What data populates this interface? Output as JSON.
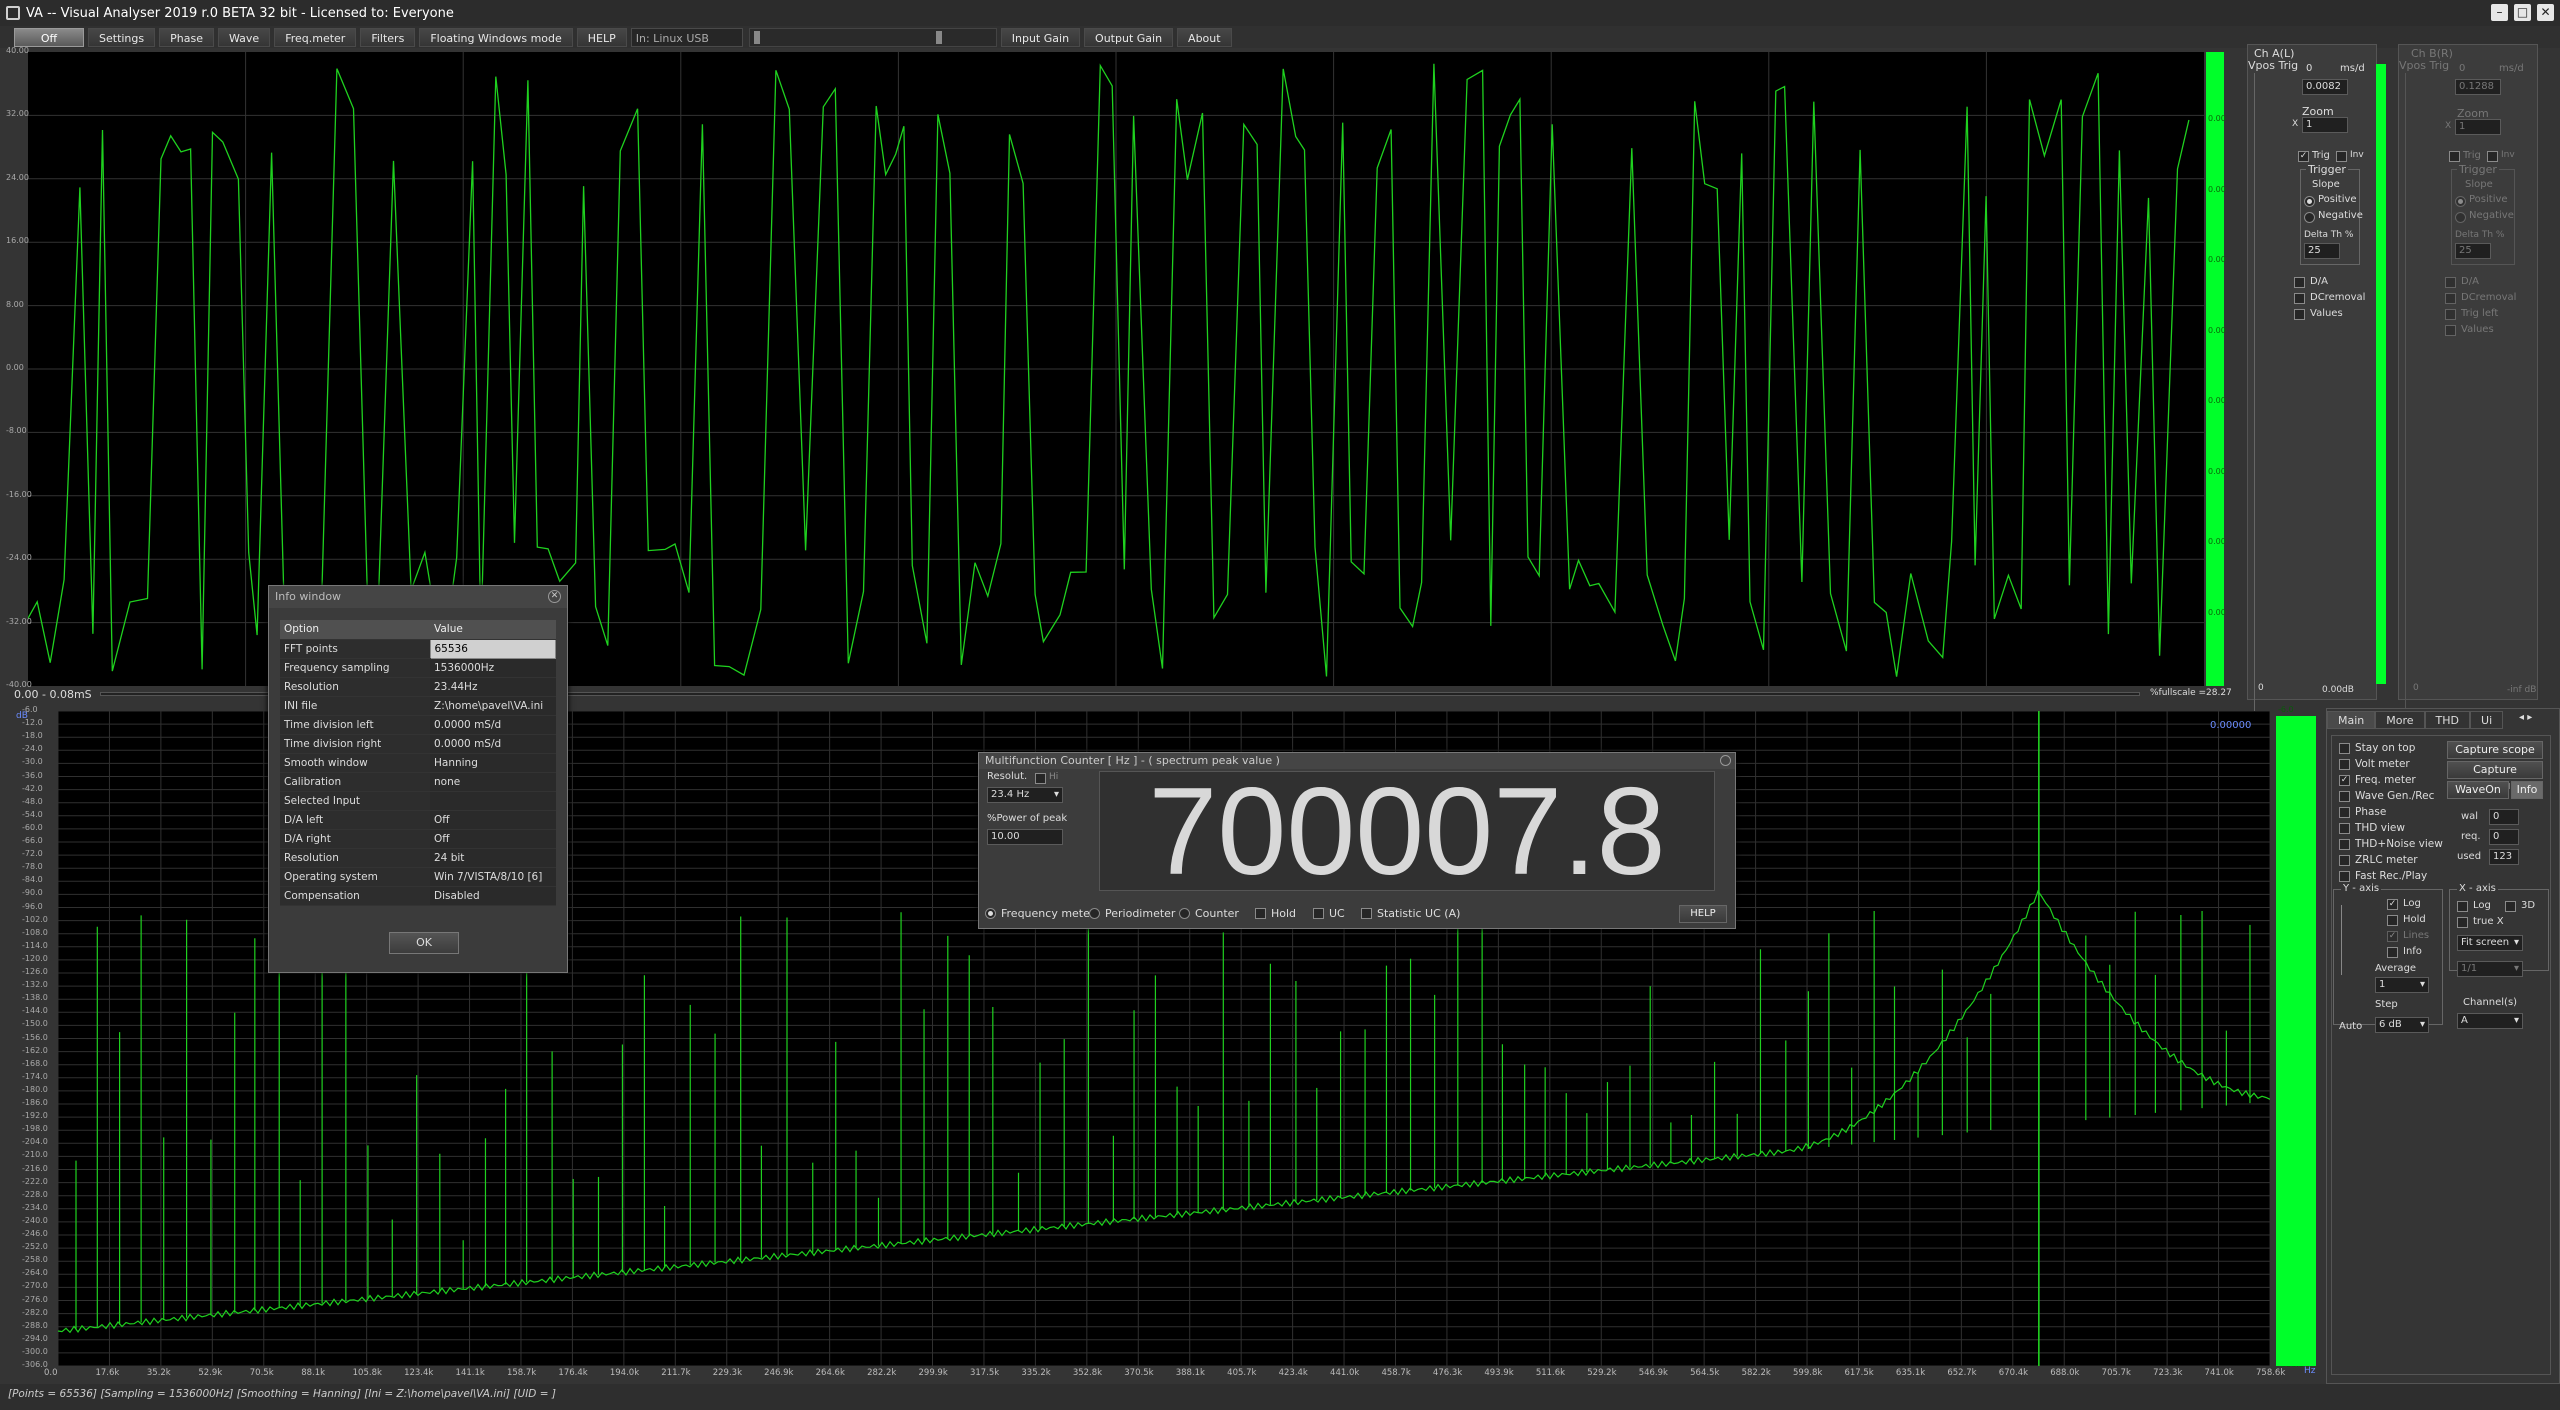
{
  "window": {
    "title": "VA -- Visual Analyser 2019 r.0 BETA 32 bit - Licensed to: Everyone"
  },
  "menu": {
    "items": [
      "Off",
      "Settings",
      "Phase",
      "Wave",
      "Freq.meter",
      "Filters",
      "Floating Windows mode",
      "HELP"
    ],
    "input_device": "In: Linux USB Audio",
    "input_gain": "Input Gain",
    "output_gain": "Output Gain",
    "about": "About"
  },
  "scope": {
    "y_ticks": [
      "40.00",
      "32.00",
      "24.00",
      "16.00",
      "8.00",
      "0.00",
      "-8.00",
      "-16.00",
      "-24.00",
      "-32.00",
      "-40.00"
    ],
    "right_ticks": [
      "0.00",
      "0.00",
      "0.00",
      "0.00",
      "0.00",
      "0.00",
      "0.00",
      "0.00"
    ],
    "time_label": "0.00 - 0.08mS",
    "fullscale_label": "%fullscale =28.27"
  },
  "ch_a": {
    "title": "Ch A(L)",
    "vpos_trig": "Vpos Trig",
    "ms_unit": "ms/d",
    "ms_a": "0",
    "ms_b": "0.0082",
    "zoom_label": "Zoom",
    "zoom_value": "1",
    "x_label": "X",
    "trig_label": "Trig",
    "inv_label": "Inv",
    "trigger_title": "Trigger",
    "slope_label": "Slope",
    "positive": "Positive",
    "negative": "Negative",
    "delta_label": "Delta Th %",
    "delta_value": "25",
    "da": "D/A",
    "dcremoval": "DCremoval",
    "values": "Values",
    "db_label": "0.00dB",
    "zero_label": "0"
  },
  "ch_b": {
    "title": "Ch B(R)",
    "vpos_trig": "Vpos Trig",
    "ms_unit": "ms/d",
    "ms_a": "0",
    "ms_b": "0.1288",
    "zoom_label": "Zoom",
    "zoom_value": "1",
    "x_label": "X",
    "trig_label": "Trig",
    "inv_label": "Inv",
    "trigger_title": "Trigger",
    "slope_label": "Slope",
    "positive": "Positive",
    "negative": "Negative",
    "delta_label": "Delta Th %",
    "delta_value": "25",
    "da": "D/A",
    "dcremoval": "DCremoval",
    "trig_left": "Trig left",
    "values": "Values",
    "db_label": "-inf dB",
    "zero_label": "0"
  },
  "spectrum": {
    "y_ticks": [
      "-6.0",
      "-12.0",
      "-18.0",
      "-24.0",
      "-30.0",
      "-36.0",
      "-42.0",
      "-48.0",
      "-54.0",
      "-60.0",
      "-66.0",
      "-72.0",
      "-78.0",
      "-84.0",
      "-90.0",
      "-96.0",
      "-102.0",
      "-108.0",
      "-114.0",
      "-120.0",
      "-126.0",
      "-132.0",
      "-138.0",
      "-144.0",
      "-150.0",
      "-156.0",
      "-162.0",
      "-168.0",
      "-174.0",
      "-180.0",
      "-186.0",
      "-192.0",
      "-198.0",
      "-204.0",
      "-210.0",
      "-216.0",
      "-222.0",
      "-228.0",
      "-234.0",
      "-240.0",
      "-246.0",
      "-252.0",
      "-258.0",
      "-264.0",
      "-270.0",
      "-276.0",
      "-282.0",
      "-288.0",
      "-294.0",
      "-300.0",
      "-306.0"
    ],
    "x_ticks": [
      "0.0",
      "17.6k",
      "35.2k",
      "52.9k",
      "70.5k",
      "88.1k",
      "105.8k",
      "123.4k",
      "141.1k",
      "158.7k",
      "176.4k",
      "194.0k",
      "211.7k",
      "229.3k",
      "246.9k",
      "264.6k",
      "282.2k",
      "299.9k",
      "317.5k",
      "335.2k",
      "352.8k",
      "370.5k",
      "388.1k",
      "405.7k",
      "423.4k",
      "441.0k",
      "458.7k",
      "476.3k",
      "493.9k",
      "511.6k",
      "529.2k",
      "546.9k",
      "564.5k",
      "582.2k",
      "599.8k",
      "617.5k",
      "635.1k",
      "652.7k",
      "670.4k",
      "688.0k",
      "705.7k",
      "723.3k",
      "741.0k",
      "758.6k"
    ],
    "corner_left": "dB",
    "corner_right": "Hz",
    "peak_readout": "0.00000"
  },
  "info_window": {
    "title": "Info window",
    "col_option": "Option",
    "col_value": "Value",
    "rows": [
      [
        "FFT points",
        "65536"
      ],
      [
        "Frequency sampling",
        "1536000Hz"
      ],
      [
        "Resolution",
        "23.44Hz"
      ],
      [
        "INI file",
        "Z:\\home\\pavel\\VA.ini"
      ],
      [
        "Time division left",
        "0.0000 mS/d"
      ],
      [
        "Time division right",
        "0.0000 mS/d"
      ],
      [
        "Smooth window",
        "Hanning"
      ],
      [
        "Calibration",
        "none"
      ],
      [
        "Selected Input",
        ""
      ],
      [
        "D/A left",
        "Off"
      ],
      [
        "D/A right",
        "Off"
      ],
      [
        "Resolution",
        "24 bit"
      ],
      [
        "Operating system",
        "Win 7/VISTA/8/10 [6]"
      ],
      [
        "Compensation",
        "Disabled"
      ]
    ],
    "ok": "OK"
  },
  "counter": {
    "title": "Multifunction Counter [ Hz ] - ( spectrum peak value )",
    "resolut_label": "Resolut.",
    "hi_label": "Hi",
    "resolut_value": "23.4 Hz",
    "power_label": "%Power of peak",
    "power_value": "10.00",
    "reading": "700007.8",
    "modes": [
      "Frequency meter",
      "Periodimeter",
      "Counter"
    ],
    "hold": "Hold",
    "uc": "UC",
    "stat": "Statistic UC (A)",
    "help": "HELP"
  },
  "right_panel": {
    "tabs": [
      "Main",
      "More",
      "THD",
      "Ui"
    ],
    "checks": [
      "Stay on top",
      "Volt meter",
      "Freq. meter",
      "Wave Gen./Rec",
      "Phase",
      "THD view",
      "THD+Noise view",
      "ZRLC meter",
      "Fast Rec./Play"
    ],
    "capture_scope": "Capture scope",
    "capture_spectrum": "Capture spectrum",
    "waveon": "WaveOn",
    "info": "Info",
    "wal_label": "wal",
    "wal_value": "0",
    "req_label": "req.",
    "req_value": "0",
    "used_label": "used",
    "used_value": "123",
    "y_axis": "Y - axis",
    "log": "Log",
    "hold": "Hold",
    "lines": "Lines",
    "info_chk": "Info",
    "average_label": "Average",
    "average_value": "1",
    "step_label": "Step",
    "step_value": "6 dB",
    "auto": "Auto",
    "x_axis": "X - axis",
    "x_log": "Log",
    "x_3d": "3D",
    "true_x": "true X",
    "fit_screen": "Fit screen",
    "ratio": "1/1",
    "channels_label": "Channel(s)",
    "channels_value": "A"
  },
  "status": {
    "text": "[Points = 65536]  [Sampling = 1536000Hz]  [Smoothing = Hanning]  [Ini = Z:\\home\\pavel\\VA.ini]  [UID = ]"
  },
  "colors": {
    "trace": "#1fd11f",
    "green_bar": "#00ff2a",
    "grid": "#3a3a3a"
  }
}
